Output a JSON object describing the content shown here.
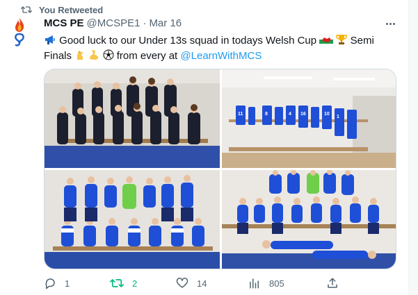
{
  "retweet_banner": {
    "text": "You Retweeted",
    "icon": "retweet-icon"
  },
  "tweet": {
    "display_name": "MCS PE",
    "handle": "@MCSPE1",
    "separator": "·",
    "date": "Mar 16",
    "text_line1": "Good luck to our Under 13s squad in todays Welsh Cup",
    "text_line1_end": "Semi",
    "text_line2_start": "Finals",
    "text_line2_mid": "from every at",
    "mention": "@LearnWithMCS",
    "emojis": [
      "megaphone-emoji",
      "wales-flag-emoji",
      "trophy-emoji",
      "crossed-fingers-emoji",
      "flexed-biceps-emoji",
      "soccer-ball-emoji"
    ]
  },
  "media": {
    "photos": [
      {
        "name": "squad-photo-uniform"
      },
      {
        "name": "changing-room-kit-photo"
      },
      {
        "name": "squad-photo-kit"
      },
      {
        "name": "squad-photo-kit-lying"
      }
    ]
  },
  "actions": {
    "reply_count": "1",
    "retweet_count": "2",
    "like_count": "14",
    "views_count": "805"
  },
  "colors": {
    "accent": "#1d9bf0",
    "retweet_green": "#00ba7c",
    "muted": "#536471",
    "kit_blue": "#1f4fd6",
    "text": "#0f1419"
  }
}
